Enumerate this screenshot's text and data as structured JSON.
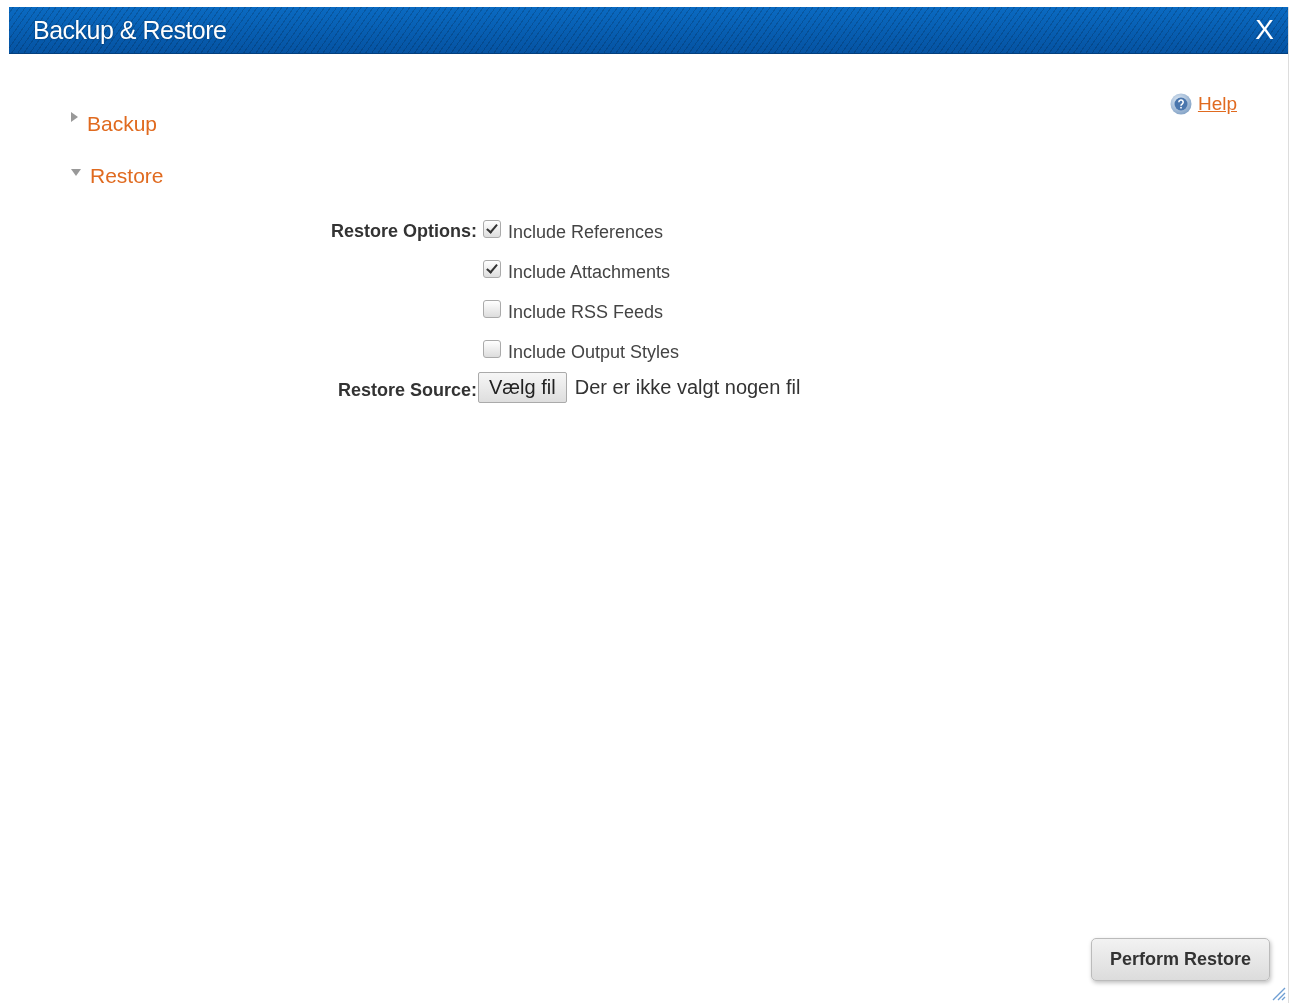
{
  "window": {
    "title": "Backup & Restore",
    "close": "X"
  },
  "help": {
    "label": "Help"
  },
  "sections": [
    {
      "label": "Backup",
      "expanded": false
    },
    {
      "label": "Restore",
      "expanded": true
    }
  ],
  "restore_options": {
    "label": "Restore Options:",
    "options": [
      {
        "label": "Include References",
        "checked": true
      },
      {
        "label": "Include Attachments",
        "checked": true
      },
      {
        "label": "Include RSS Feeds",
        "checked": false
      },
      {
        "label": "Include Output Styles",
        "checked": false
      }
    ]
  },
  "restore_source": {
    "label": "Restore Source:",
    "button": "Vælg fil",
    "status": "Der er ikke valgt nogen fil"
  },
  "buttons": [
    "Perform Restore"
  ]
}
